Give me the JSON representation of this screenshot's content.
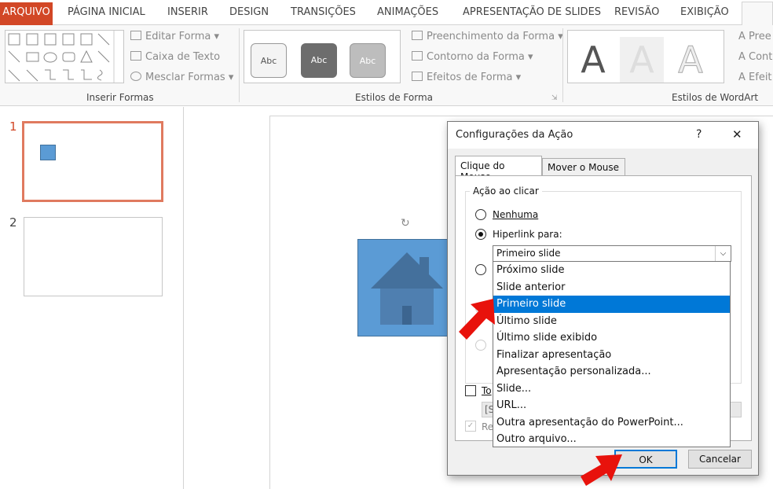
{
  "tabs": [
    "ARQUIVO",
    "PÁGINA INICIAL",
    "INSERIR",
    "DESIGN",
    "TRANSIÇÕES",
    "ANIMAÇÕES",
    "APRESENTAÇÃO DE SLIDES",
    "REVISÃO",
    "EXIBIÇÃO"
  ],
  "ribbon": {
    "insert_shapes": {
      "label": "Inserir Formas",
      "edit_shape": "Editar Forma",
      "text_box": "Caixa de Texto",
      "merge_shapes": "Mesclar Formas"
    },
    "shape_styles": {
      "label": "Estilos de Forma",
      "sample": "Abc",
      "fill": "Preenchimento da Forma",
      "outline": "Contorno da Forma",
      "effects": "Efeitos de Forma"
    },
    "wordart_styles": {
      "label": "Estilos de WordArt",
      "sample": "A",
      "fill": "Pree",
      "outline": "Cont",
      "effects": "Efeit"
    }
  },
  "thumbnails": [
    "1",
    "2"
  ],
  "dialog": {
    "title": "Configurações da Ação",
    "help": "?",
    "close": "✕",
    "tabs": [
      "Clique do Mouse",
      "Mover o Mouse"
    ],
    "group_label": "Ação ao clicar",
    "none": "Nenhuma",
    "hyperlink": "Hiperlink para:",
    "hyperlink_value": "Primeiro slide",
    "play_sound_partial": "To",
    "sound_partial": "[S",
    "highlight_partial": "Re",
    "ok": "OK",
    "cancel": "Cancelar"
  },
  "dropdown_options": [
    "Próximo slide",
    "Slide anterior",
    "Primeiro slide",
    "Último slide",
    "Último slide exibido",
    "Finalizar apresentação",
    "Apresentação personalizada...",
    "Slide...",
    "URL...",
    "Outra apresentação do PowerPoint...",
    "Outro arquivo..."
  ],
  "dropdown_selected": "Primeiro slide",
  "colors": {
    "accent": "#d24726",
    "shape": "#5b9bd5",
    "selection": "#0078d7",
    "arrow": "#e8120c"
  }
}
